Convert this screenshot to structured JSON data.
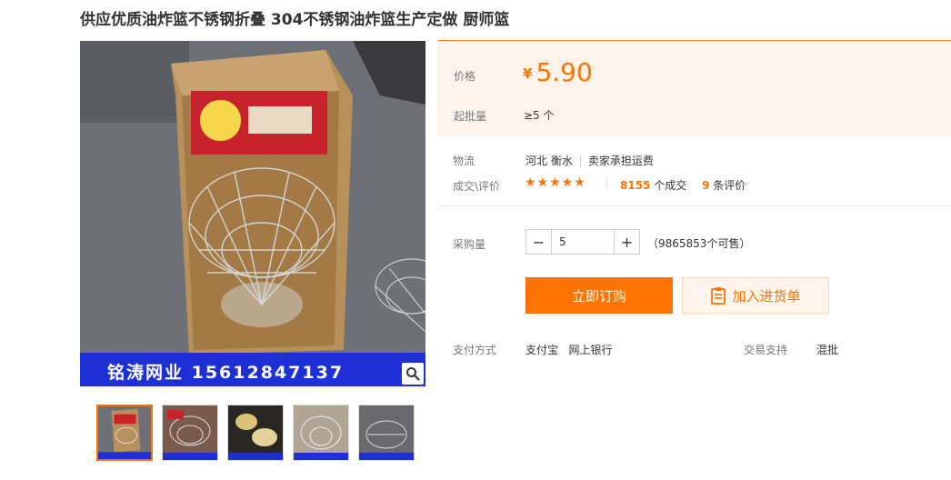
{
  "product": {
    "title": "供应优质油炸篮不锈钢折叠 304不锈钢油炸篮生产定做 厨师篮"
  },
  "gallery": {
    "watermark_text": "铭涛网业 15612847137",
    "zoom_icon": "magnifier-icon",
    "thumbnail_count": 5
  },
  "price": {
    "label": "价格",
    "currency": "¥",
    "value": "5.90"
  },
  "moq": {
    "label": "起批量",
    "value": "≥5 个"
  },
  "logistics": {
    "label": "物流",
    "location": "河北 衡水",
    "shipping": "卖家承担运费"
  },
  "deals": {
    "label": "成交\\评价",
    "stars": "★★★★★",
    "deal_count": "8155",
    "deal_suffix": "个成交",
    "review_count": "9",
    "review_suffix": "条评价"
  },
  "purchase": {
    "label": "采购量",
    "minus": "−",
    "plus": "+",
    "quantity": "5",
    "available": "（9865853个可售）"
  },
  "actions": {
    "buy_now": "立即订购",
    "add_to_cart": "加入进货单"
  },
  "payment": {
    "label": "支付方式",
    "method1": "支付宝",
    "method2": "网上银行"
  },
  "trade": {
    "label": "交易支持",
    "value": "混批"
  },
  "colors": {
    "accent": "#ff7300",
    "price_bg": "#fff4eb"
  }
}
